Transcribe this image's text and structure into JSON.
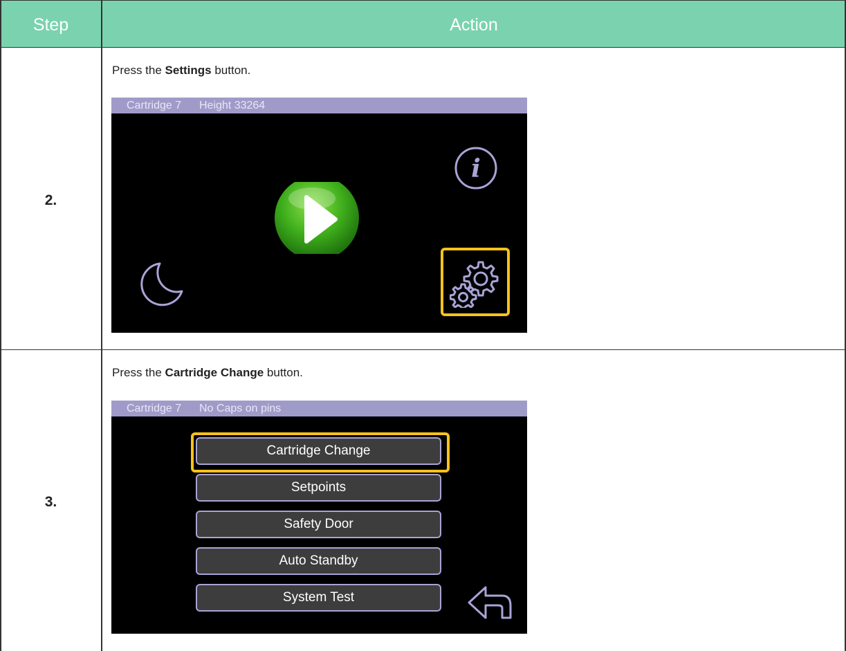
{
  "table": {
    "header": {
      "step": "Step",
      "action": "Action"
    },
    "rows": [
      {
        "step": "2.",
        "instruction_prefix": "Press the ",
        "instruction_bold": "Settings",
        "instruction_suffix": " button.",
        "screen": {
          "status_cartridge": "Cartridge 7",
          "status_info": "Height 33264",
          "icons": [
            "info-icon",
            "play-icon",
            "moon-icon",
            "settings-icon"
          ],
          "highlighted": "settings-icon"
        }
      },
      {
        "step": "3.",
        "instruction_prefix": "Press the ",
        "instruction_bold": "Cartridge Change",
        "instruction_suffix": " button.",
        "screen": {
          "status_cartridge": "Cartridge 7",
          "status_info": "No Caps on pins",
          "menu": [
            "Cartridge Change",
            "Setpoints",
            "Safety Door",
            "Auto Standby",
            "System Test"
          ],
          "icons": [
            "back-arrow-icon"
          ],
          "highlighted": "Cartridge Change"
        }
      }
    ]
  },
  "colors": {
    "header_bg": "#7ad3ae",
    "status_bar": "#9f9bc9",
    "highlight": "#f7c21b",
    "icon_stroke": "#a9a4d6",
    "play_green": "#3fae1c"
  }
}
